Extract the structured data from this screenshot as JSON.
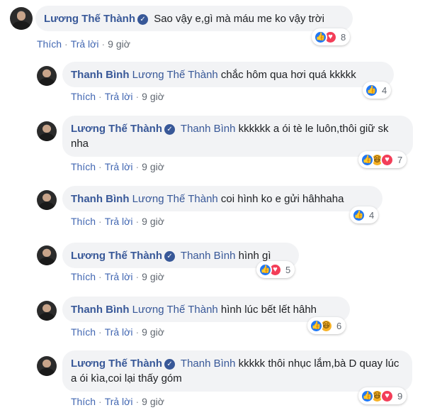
{
  "labels": {
    "like": "Thích",
    "reply": "Trả lời",
    "separator": "·"
  },
  "comments": [
    {
      "author": "Lương Thế Thành",
      "verified": true,
      "mention": "",
      "text": "Sao vậy e,gì mà máu me ko vậy trời",
      "time": "9 giờ",
      "reactions": [
        "like",
        "love"
      ],
      "count": "8"
    },
    {
      "author": "Thanh Bình",
      "verified": false,
      "mention": "Lương Thế Thành",
      "text": "chắc hôm qua hơi quá kkkkk",
      "time": "9 giờ",
      "reactions": [
        "like"
      ],
      "count": "4"
    },
    {
      "author": "Lương Thế Thành",
      "verified": true,
      "mention": "Thanh Bình",
      "text": "kkkkkk a ói tè le luôn,thôi giữ sk nha",
      "time": "9 giờ",
      "reactions": [
        "like",
        "haha",
        "love"
      ],
      "count": "7"
    },
    {
      "author": "Thanh Bình",
      "verified": false,
      "mention": "Lương Thế Thành",
      "text": "coi hình ko e gửi hâhhaha",
      "time": "9 giờ",
      "reactions": [
        "like"
      ],
      "count": "4"
    },
    {
      "author": "Lương Thế Thành",
      "verified": true,
      "mention": "Thanh Bình",
      "text": "hình gì",
      "time": "9 giờ",
      "reactions": [
        "like",
        "love"
      ],
      "count": "5"
    },
    {
      "author": "Thanh Bình",
      "verified": false,
      "mention": "Lương Thế Thành",
      "text": "hình lúc bết lết hâhh",
      "time": "9 giờ",
      "reactions": [
        "like",
        "haha"
      ],
      "count": "6"
    },
    {
      "author": "Lương Thế Thành",
      "verified": true,
      "mention": "Thanh Bình",
      "text": "kkkkk thôi nhục lắm,bà D quay lúc a ói kìa,coi lại thấy góm",
      "time": "9 giờ",
      "reactions": [
        "like",
        "haha",
        "love"
      ],
      "count": "9"
    }
  ],
  "icons": {
    "verified": "verified-check-icon",
    "like": "like-reaction-icon",
    "love": "love-reaction-icon",
    "haha": "haha-reaction-icon"
  },
  "colors": {
    "link": "#385898",
    "bubble": "#f2f3f5",
    "like": "#2078f4",
    "love": "#f33e58",
    "haha": "#f7b125"
  }
}
